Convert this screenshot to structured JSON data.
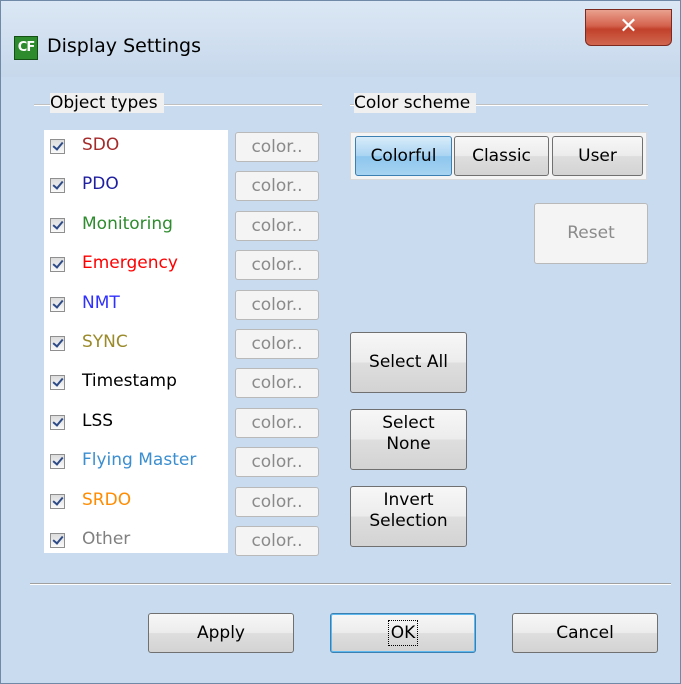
{
  "window": {
    "title": "Display Settings",
    "app_icon_text": "CF",
    "close_glyph": "✕"
  },
  "object_types": {
    "label": "Object types",
    "color_button_label": "color..",
    "items": [
      {
        "label": "SDO",
        "color": "#a52a2a",
        "checked": true
      },
      {
        "label": "PDO",
        "color": "#1f1fa0",
        "checked": true
      },
      {
        "label": "Monitoring",
        "color": "#2e8b2e",
        "checked": true
      },
      {
        "label": "Emergency",
        "color": "#ff0000",
        "checked": true
      },
      {
        "label": "NMT",
        "color": "#3030ff",
        "checked": true
      },
      {
        "label": "SYNC",
        "color": "#9a8a2a",
        "checked": true
      },
      {
        "label": "Timestamp",
        "color": "#000000",
        "checked": true
      },
      {
        "label": "LSS",
        "color": "#000000",
        "checked": true
      },
      {
        "label": "Flying Master",
        "color": "#3b8ed0",
        "checked": true
      },
      {
        "label": "SRDO",
        "color": "#ff8c00",
        "checked": true
      },
      {
        "label": "Other",
        "color": "#808080",
        "checked": true
      }
    ]
  },
  "color_scheme": {
    "label": "Color scheme",
    "options": [
      "Colorful",
      "Classic",
      "User"
    ],
    "selected": "Colorful",
    "reset_label": "Reset"
  },
  "selection": {
    "select_all": "Select All",
    "select_none_1": "Select",
    "select_none_2": "None",
    "invert_1": "Invert",
    "invert_2": "Selection"
  },
  "footer": {
    "apply": "Apply",
    "ok": "OK",
    "cancel": "Cancel"
  }
}
